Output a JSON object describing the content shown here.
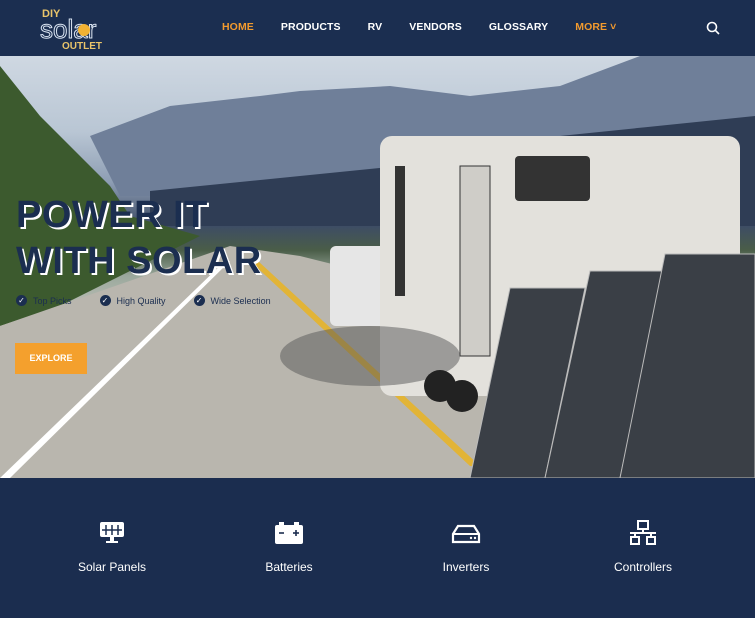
{
  "logo": {
    "text_top": "DIY",
    "text_mid": "Solar",
    "text_bottom": "OUTLET"
  },
  "nav": {
    "items": [
      {
        "label": "HOME",
        "active": true
      },
      {
        "label": "PRODUCTS"
      },
      {
        "label": "RV"
      },
      {
        "label": "VENDORS"
      },
      {
        "label": "GLOSSARY"
      },
      {
        "label": "MORE ˅"
      }
    ]
  },
  "hero": {
    "title_line1": "POWER IT",
    "title_line2": "WITH SOLAR",
    "features": [
      "Top Picks",
      "High Quality",
      "Wide Selection"
    ],
    "cta": "EXPLORE"
  },
  "categories": [
    {
      "label": "Solar Panels",
      "icon": "solar-panel-icon"
    },
    {
      "label": "Batteries",
      "icon": "battery-icon"
    },
    {
      "label": "Inverters",
      "icon": "inverter-icon"
    },
    {
      "label": "Controllers",
      "icon": "network-icon"
    }
  ],
  "colors": {
    "navy": "#1b2e50",
    "accent": "#f29a2e",
    "button": "#f4a02d"
  }
}
